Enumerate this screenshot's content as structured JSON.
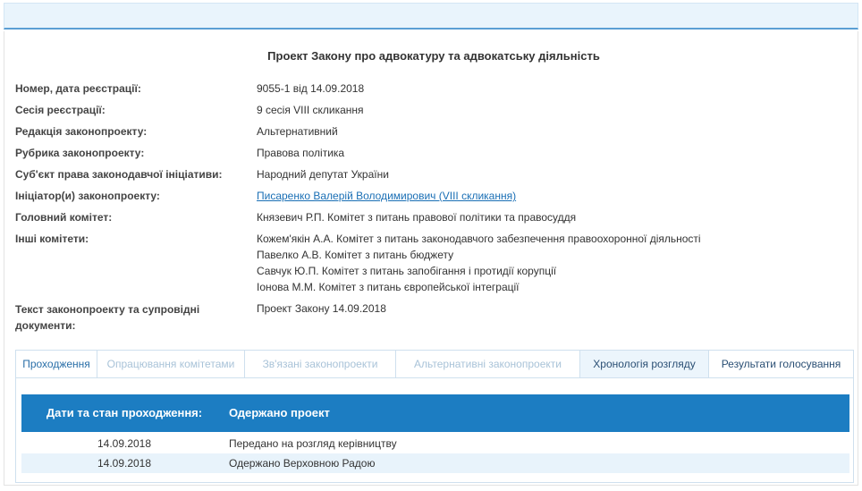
{
  "title": "Проект Закону про адвокатуру та адвокатську діяльність",
  "fields": [
    {
      "label": "Номер, дата реєстрації:",
      "value": "9055-1 від 14.09.2018"
    },
    {
      "label": "Сесія реєстрації:",
      "value": "9 сесія VIII скликання"
    },
    {
      "label": "Редакція законопроекту:",
      "value": "Альтернативний"
    },
    {
      "label": "Рубрика законопроекту:",
      "value": "Правова політика"
    },
    {
      "label": "Суб'єкт права законодавчої ініціативи:",
      "value": "Народний депутат України"
    },
    {
      "label": "Ініціатор(и) законопроекту:",
      "value": "Писаренко Валерій Володимирович (VIII скликання)"
    },
    {
      "label": "Головний комітет:",
      "value": "Князевич Р.П. Комітет з питань правової політики та правосуддя"
    }
  ],
  "other_committees": {
    "label": "Інші комітети:",
    "items": [
      "Кожем'якін А.А. Комітет з питань законодавчого забезпечення правоохоронної діяльності",
      "Павелко А.В. Комітет з питань бюджету",
      "Савчук Ю.П. Комітет з питань запобігання і протидії корупції",
      "Іонова М.М. Комітет з питань європейської інтеграції"
    ]
  },
  "documents": {
    "label": "Текст законопроекту та супровідні документи:",
    "value": "Проект Закону 14.09.2018"
  },
  "tabs": [
    {
      "label": "Проходження",
      "state": "active"
    },
    {
      "label": "Опрацювання комітетами",
      "state": "disabled"
    },
    {
      "label": "Зв'язані законопроекти",
      "state": "disabled"
    },
    {
      "label": "Альтернативні законопроекти",
      "state": "disabled"
    },
    {
      "label": "Хронологія розгляду",
      "state": "highlighted"
    },
    {
      "label": "Результати голосування",
      "state": "normal"
    }
  ],
  "progress_table": {
    "header_dates": "Дати та стан проходження:",
    "header_status": "Одержано проект",
    "rows": [
      {
        "date": "14.09.2018",
        "text": "Передано на розгляд керівництву"
      },
      {
        "date": "14.09.2018",
        "text": "Одержано Верховною Радою"
      }
    ]
  },
  "colors": {
    "header_blue": "#1c7dc2",
    "link": "#1a6fb5",
    "topbar": "#e9f4fc",
    "row_alt": "#e8f3fb"
  }
}
